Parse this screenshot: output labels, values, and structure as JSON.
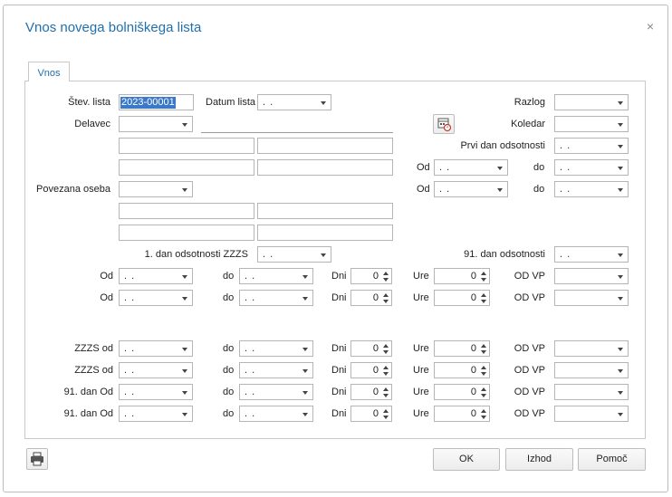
{
  "dialog": {
    "title": "Vnos novega bolniškega lista",
    "close_symbol": "×"
  },
  "tab": {
    "label": "Vnos"
  },
  "fields": {
    "stev_lista_label": "Štev. lista",
    "stev_lista_value": "2023-00001",
    "datum_lista_label": "Datum lista",
    "razlog_label": "Razlog",
    "delavec_label": "Delavec",
    "koledar_label": "Koledar",
    "prvi_dan_label": "Prvi dan odsotnosti",
    "od_label": "Od",
    "do_label": "do",
    "povezana_oseba_label": "Povezana oseba",
    "prvi_dan_zzzs_label": "1. dan odsotnosti ZZZS",
    "dan91_label": "91. dan odsotnosti",
    "dni_label": "Dni",
    "ure_label": "Ure",
    "od_vp_label": "OD VP",
    "zzzs_od_label": "ZZZS od",
    "dan91_od_label": "91. dan Od",
    "date_empty": ". .",
    "spin_zero": "0"
  },
  "buttons": {
    "ok": "OK",
    "izhod": "Izhod",
    "pomoc": "Pomoč"
  }
}
